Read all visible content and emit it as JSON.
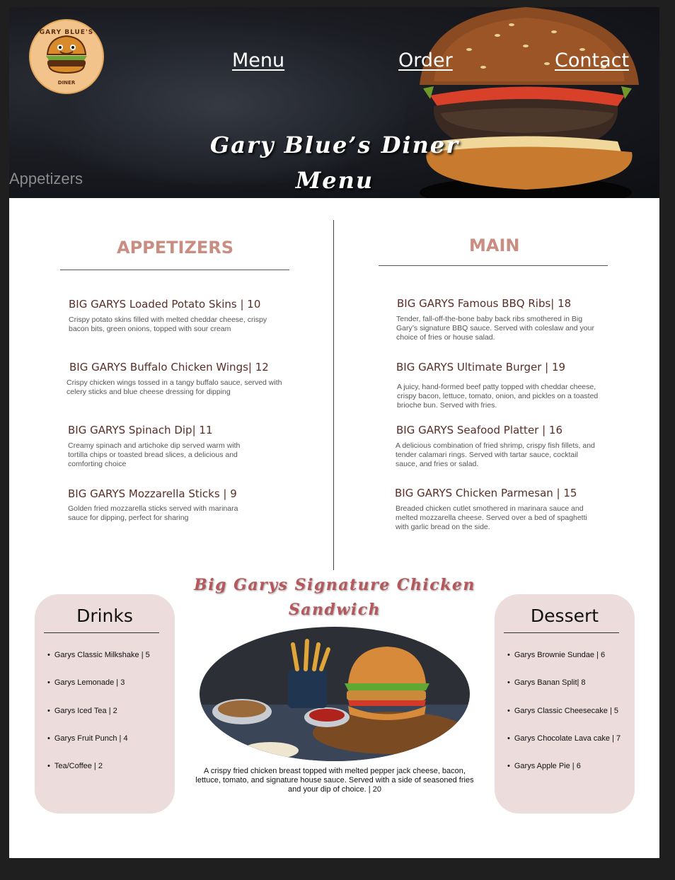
{
  "frame_label": "Appetizers",
  "logo": {
    "top_text": "GARY BLUE'S",
    "bottom_text": "DINER",
    "est_left": "ESTD",
    "est_right": "2024"
  },
  "nav": {
    "menu": "Menu",
    "order": "Order",
    "contact": "Contact"
  },
  "hero": {
    "title_line1": "Gary Blue’s Diner",
    "title_line2": "Menu"
  },
  "appetizers": {
    "title": "APPETIZERS",
    "items": [
      {
        "name": "BIG GARYS Loaded Potato Skins | 10",
        "desc": "Crispy potato skins filled with melted cheddar cheese, crispy bacon bits, green onions, topped with sour cream"
      },
      {
        "name": "BIG GARYS Buffalo Chicken Wings| 12",
        "desc": "Crispy chicken wings tossed in a tangy buffalo sauce, served with celery sticks and blue cheese dressing for dipping"
      },
      {
        "name": "BIG GARYS Spinach Dip| 11",
        "desc": "Creamy spinach and artichoke dip served warm with tortilla chips or toasted bread slices, a delicious and comforting choice"
      },
      {
        "name": "BIG GARYS Mozzarella Sticks  | 9",
        "desc": "Golden fried mozzarella sticks served with marinara sauce for dipping, perfect for sharing"
      }
    ]
  },
  "main": {
    "title": "MAIN",
    "items": [
      {
        "name": "BIG GARYS Famous BBQ Ribs| 18",
        "desc": "Tender, fall-off-the-bone baby back ribs smothered in Big Gary’s signature BBQ sauce. Served with coleslaw and your choice of fries or house salad."
      },
      {
        "name": "BIG GARYS Ultimate Burger | 19",
        "desc": "A juicy, hand-formed beef patty topped with cheddar cheese, crispy bacon, lettuce, tomato, onion, and pickles on a toasted brioche bun. Served with fries."
      },
      {
        "name": "BIG GARYS Seafood Platter | 16",
        "desc": "A delicious combination of fried shrimp, crispy fish fillets, and tender calamari rings. Served with tartar sauce, cocktail sauce, and fries or salad."
      },
      {
        "name": "BIG GARYS Chicken Parmesan | 15",
        "desc": "Breaded chicken cutlet smothered in marinara sauce and melted mozzarella cheese. Served over a bed of spaghetti with garlic bread on the side."
      }
    ]
  },
  "drinks": {
    "title": "Drinks",
    "items": [
      "Garys Classic Milkshake | 5",
      "Garys Lemonade | 3",
      "Garys Iced Tea | 2",
      "Garys Fruit Punch | 4",
      "Tea/Coffee | 2"
    ]
  },
  "dessert": {
    "title": "Dessert",
    "items": [
      "Garys Brownie Sundae | 6",
      "Garys Banan Split| 8",
      "Garys Classic Cheesecake | 5",
      "Garys Chocolate Lava cake | 7",
      "Garys Apple Pie | 6"
    ]
  },
  "feature": {
    "title_line1": "Big Garys Signature Chicken",
    "title_line2": "Sandwich",
    "desc": "A crispy fried chicken breast topped with melted pepper jack cheese, bacon, lettuce, tomato, and signature house sauce. Served with a side of seasoned fries and your dip of choice. | 20"
  },
  "colors": {
    "section_title": "#c98e82",
    "item_name": "#5a2e28",
    "card_bg": "#ecdcdc",
    "feature_title": "#b5575b"
  }
}
